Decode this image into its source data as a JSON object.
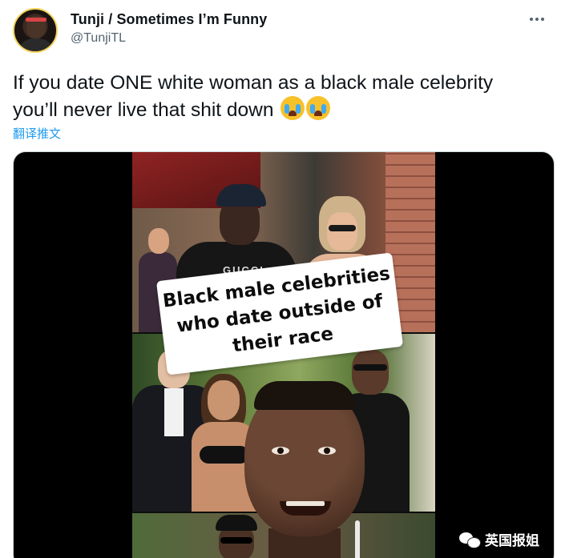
{
  "author": {
    "display_name": "Tunji / Sometimes I’m Funny",
    "handle": "@TunjiTL",
    "avatar_icon": "profile-photo"
  },
  "tweet": {
    "text_line1": "If you date ONE white woman as a black male celebrity",
    "text_line2": "you’ll never live that shit down",
    "emoji": "loudly-crying-face",
    "translate_label": "翻译推文"
  },
  "media": {
    "caption_lines": [
      "Black male celebrities",
      "who date outside of",
      "their race"
    ],
    "shirt_logo": "GUCCI"
  },
  "watermark": {
    "text": "英国报姐",
    "icon": "wechat-icon"
  },
  "colors": {
    "link": "#1d9bf0",
    "text": "#0f1419",
    "secondary": "#536471"
  }
}
